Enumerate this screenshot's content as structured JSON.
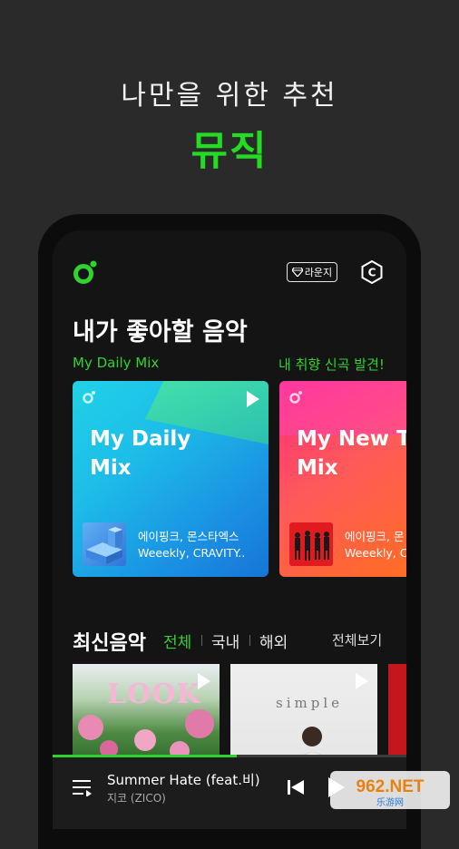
{
  "promo": {
    "subtitle": "나만을 위한 추천",
    "title": "뮤직"
  },
  "header": {
    "lounge_label": "라운지",
    "coin_label": "C"
  },
  "recommend": {
    "title": "내가 좋아할 음악",
    "mix_label": "My Daily Mix",
    "new_label": "내 취향 신곡 발견!",
    "cards": [
      {
        "title": "My Daily\nMix",
        "artists_line1": "에이핑크, 몬스타엑스",
        "artists_line2": "Weeekly, CRAVITY.."
      },
      {
        "title": "My New Tr\nMix",
        "artists_line1": "에이핑크, 몬",
        "artists_line2": "Weeekly, CR"
      }
    ]
  },
  "latest": {
    "title": "최신음악",
    "tabs": [
      "전체",
      "국내",
      "해외"
    ],
    "see_all": "전체보기",
    "albums": [
      {
        "cover_text": "LOOK"
      },
      {
        "cover_text": "simple"
      }
    ]
  },
  "player": {
    "song_title": "Summer Hate (feat.비)",
    "artist": "지코 (ZICO)",
    "progress": 0.52
  },
  "watermark": {
    "text": "962.NET",
    "sub": "乐游网"
  },
  "colors": {
    "accent": "#2fd22f",
    "background": "#2a2a2a",
    "screen": "#141414"
  }
}
